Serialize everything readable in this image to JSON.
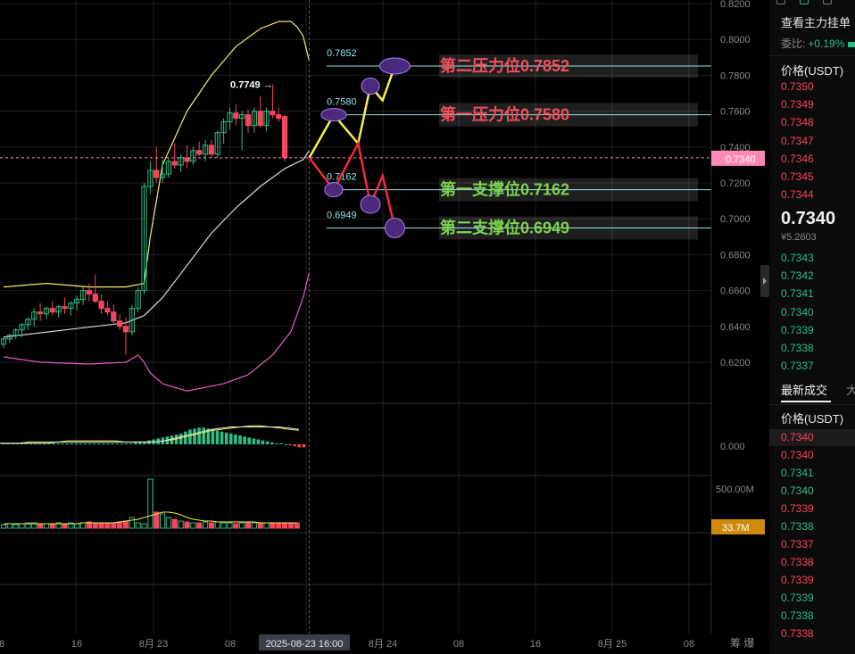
{
  "chart_data": {
    "type": "candlestick",
    "y_axis": {
      "ticks": [
        "0.8200",
        "0.8000",
        "0.7800",
        "0.7600",
        "0.7400",
        "0.7200",
        "0.7000",
        "0.6800",
        "0.6600",
        "0.6400",
        "0.6200"
      ],
      "ylim": [
        0.612,
        0.822
      ],
      "current_price_label": "0.7340"
    },
    "x_axis": {
      "ticks": [
        "8",
        "16",
        "8月 23",
        "08",
        "2025-08-23 16:00",
        "8月 24",
        "08",
        "16",
        "8月 25",
        "08"
      ],
      "crosshair_label": "2025-08-23 16:00"
    },
    "corner_label": "筹 爆",
    "candles": [
      {
        "o": 0.63,
        "h": 0.634,
        "l": 0.628,
        "c": 0.633
      },
      {
        "o": 0.633,
        "h": 0.636,
        "l": 0.631,
        "c": 0.635
      },
      {
        "o": 0.635,
        "h": 0.639,
        "l": 0.633,
        "c": 0.638
      },
      {
        "o": 0.638,
        "h": 0.642,
        "l": 0.634,
        "c": 0.641
      },
      {
        "o": 0.641,
        "h": 0.645,
        "l": 0.638,
        "c": 0.644
      },
      {
        "o": 0.644,
        "h": 0.65,
        "l": 0.64,
        "c": 0.648
      },
      {
        "o": 0.648,
        "h": 0.653,
        "l": 0.643,
        "c": 0.647
      },
      {
        "o": 0.647,
        "h": 0.651,
        "l": 0.644,
        "c": 0.65
      },
      {
        "o": 0.65,
        "h": 0.654,
        "l": 0.646,
        "c": 0.648
      },
      {
        "o": 0.648,
        "h": 0.652,
        "l": 0.645,
        "c": 0.651
      },
      {
        "o": 0.651,
        "h": 0.656,
        "l": 0.647,
        "c": 0.65
      },
      {
        "o": 0.65,
        "h": 0.654,
        "l": 0.646,
        "c": 0.653
      },
      {
        "o": 0.653,
        "h": 0.657,
        "l": 0.649,
        "c": 0.655
      },
      {
        "o": 0.655,
        "h": 0.662,
        "l": 0.652,
        "c": 0.66
      },
      {
        "o": 0.66,
        "h": 0.664,
        "l": 0.654,
        "c": 0.658
      },
      {
        "o": 0.658,
        "h": 0.669,
        "l": 0.653,
        "c": 0.654
      },
      {
        "o": 0.654,
        "h": 0.658,
        "l": 0.647,
        "c": 0.65
      },
      {
        "o": 0.65,
        "h": 0.654,
        "l": 0.646,
        "c": 0.648
      },
      {
        "o": 0.648,
        "h": 0.652,
        "l": 0.641,
        "c": 0.643
      },
      {
        "o": 0.643,
        "h": 0.647,
        "l": 0.638,
        "c": 0.64
      },
      {
        "o": 0.64,
        "h": 0.645,
        "l": 0.624,
        "c": 0.637
      },
      {
        "o": 0.637,
        "h": 0.652,
        "l": 0.635,
        "c": 0.65
      },
      {
        "o": 0.65,
        "h": 0.662,
        "l": 0.648,
        "c": 0.66
      },
      {
        "o": 0.66,
        "h": 0.72,
        "l": 0.658,
        "c": 0.718
      },
      {
        "o": 0.718,
        "h": 0.732,
        "l": 0.714,
        "c": 0.727
      },
      {
        "o": 0.727,
        "h": 0.74,
        "l": 0.72,
        "c": 0.723
      },
      {
        "o": 0.723,
        "h": 0.733,
        "l": 0.72,
        "c": 0.725
      },
      {
        "o": 0.725,
        "h": 0.734,
        "l": 0.723,
        "c": 0.732
      },
      {
        "o": 0.732,
        "h": 0.742,
        "l": 0.728,
        "c": 0.73
      },
      {
        "o": 0.73,
        "h": 0.736,
        "l": 0.726,
        "c": 0.734
      },
      {
        "o": 0.734,
        "h": 0.741,
        "l": 0.728,
        "c": 0.732
      },
      {
        "o": 0.732,
        "h": 0.74,
        "l": 0.73,
        "c": 0.738
      },
      {
        "o": 0.738,
        "h": 0.743,
        "l": 0.735,
        "c": 0.736
      },
      {
        "o": 0.736,
        "h": 0.744,
        "l": 0.732,
        "c": 0.741
      },
      {
        "o": 0.741,
        "h": 0.744,
        "l": 0.734,
        "c": 0.736
      },
      {
        "o": 0.736,
        "h": 0.749,
        "l": 0.734,
        "c": 0.748
      },
      {
        "o": 0.748,
        "h": 0.756,
        "l": 0.742,
        "c": 0.754
      },
      {
        "o": 0.754,
        "h": 0.762,
        "l": 0.75,
        "c": 0.759
      },
      {
        "o": 0.759,
        "h": 0.764,
        "l": 0.752,
        "c": 0.756
      },
      {
        "o": 0.756,
        "h": 0.76,
        "l": 0.738,
        "c": 0.758
      },
      {
        "o": 0.758,
        "h": 0.761,
        "l": 0.748,
        "c": 0.752
      },
      {
        "o": 0.752,
        "h": 0.762,
        "l": 0.748,
        "c": 0.76
      },
      {
        "o": 0.76,
        "h": 0.768,
        "l": 0.751,
        "c": 0.752
      },
      {
        "o": 0.752,
        "h": 0.762,
        "l": 0.749,
        "c": 0.76
      },
      {
        "o": 0.76,
        "h": 0.7749,
        "l": 0.756,
        "c": 0.758
      },
      {
        "o": 0.758,
        "h": 0.762,
        "l": 0.754,
        "c": 0.756
      },
      {
        "o": 0.757,
        "h": 0.758,
        "l": 0.732,
        "c": 0.734
      }
    ],
    "high_marker": {
      "price": 0.7749,
      "label": "0.7749 →"
    },
    "bands": {
      "upper": [
        [
          0,
          0.662
        ],
        [
          7,
          0.664
        ],
        [
          14,
          0.662
        ],
        [
          20,
          0.662
        ],
        [
          23,
          0.664
        ],
        [
          24,
          0.69
        ],
        [
          26,
          0.73
        ],
        [
          30,
          0.76
        ],
        [
          34,
          0.78
        ],
        [
          38,
          0.796
        ],
        [
          42,
          0.806
        ],
        [
          45,
          0.81
        ],
        [
          47,
          0.81
        ],
        [
          48,
          0.807
        ],
        [
          49,
          0.802
        ],
        [
          50,
          0.788
        ]
      ],
      "middle": [
        [
          0,
          0.634
        ],
        [
          10,
          0.638
        ],
        [
          20,
          0.642
        ],
        [
          23,
          0.646
        ],
        [
          26,
          0.656
        ],
        [
          30,
          0.674
        ],
        [
          34,
          0.692
        ],
        [
          38,
          0.706
        ],
        [
          42,
          0.718
        ],
        [
          46,
          0.728
        ],
        [
          49,
          0.733
        ],
        [
          50,
          0.738
        ]
      ],
      "lower": [
        [
          0,
          0.623
        ],
        [
          6,
          0.62
        ],
        [
          14,
          0.619
        ],
        [
          20,
          0.62
        ],
        [
          22,
          0.624
        ],
        [
          23,
          0.62
        ],
        [
          24,
          0.614
        ],
        [
          26,
          0.608
        ],
        [
          30,
          0.604
        ],
        [
          36,
          0.608
        ],
        [
          40,
          0.613
        ],
        [
          44,
          0.624
        ],
        [
          47,
          0.637
        ],
        [
          49,
          0.656
        ],
        [
          50,
          0.67
        ]
      ]
    },
    "levels": [
      {
        "price": 0.7852,
        "small_label": "0.7852",
        "label": "第二压力位0.7852",
        "color": "#f24e5c"
      },
      {
        "price": 0.758,
        "small_label": "0.7580",
        "label": "第一压力位0.7580",
        "color": "#f24e5c"
      },
      {
        "price": 0.7162,
        "small_label": "0.7162",
        "label": "第一支撑位0.7162",
        "color": "#7dd34f"
      },
      {
        "price": 0.6949,
        "small_label": "0.6949",
        "label": "第二支撑位0.6949",
        "color": "#7dd34f"
      }
    ],
    "projection_bull": [
      [
        50,
        0.734
      ],
      [
        54,
        0.758
      ],
      [
        58,
        0.742
      ],
      [
        60,
        0.774
      ],
      [
        62,
        0.766
      ],
      [
        64,
        0.7852
      ]
    ],
    "projection_bear": [
      [
        50,
        0.734
      ],
      [
        54,
        0.7162
      ],
      [
        58,
        0.742
      ],
      [
        60,
        0.708
      ],
      [
        62,
        0.724
      ],
      [
        64,
        0.6949
      ]
    ],
    "macd": {
      "zero_label": "0.000",
      "hist": [
        1,
        1,
        1,
        1,
        1,
        1,
        1,
        1,
        1,
        1,
        1,
        1,
        1,
        1,
        1,
        1,
        1,
        1,
        1,
        1,
        1,
        1,
        1,
        1,
        1,
        1,
        1,
        1,
        1,
        2,
        2,
        3,
        4,
        5,
        6,
        7,
        8,
        9,
        10,
        11,
        13,
        15,
        16,
        17,
        17,
        16,
        15,
        14,
        13,
        12,
        11,
        10,
        9,
        8,
        7,
        6,
        5,
        4,
        3,
        2,
        1,
        1,
        0,
        -1,
        -2,
        -3,
        -3
      ],
      "line_a": [
        1,
        1,
        1,
        2,
        2,
        2,
        2,
        3,
        3,
        3,
        3,
        3,
        3,
        2,
        2,
        2,
        2,
        3,
        4,
        6,
        8,
        10,
        12,
        13,
        14,
        15,
        15,
        15,
        15,
        14,
        13,
        12
      ],
      "line_b": [
        1,
        1,
        1,
        1,
        1,
        1,
        2,
        2,
        2,
        2,
        2,
        2,
        2,
        2,
        2,
        2,
        2,
        3,
        5,
        7,
        9,
        11,
        13,
        14,
        15,
        15,
        16,
        16,
        15,
        15,
        14,
        13
      ]
    },
    "volume": {
      "axis_label": "500.00M",
      "current_label": "33.7M",
      "values": [
        4,
        5,
        4,
        5,
        6,
        6,
        5,
        5,
        5,
        6,
        5,
        6,
        5,
        6,
        7,
        6,
        5,
        6,
        6,
        7,
        8,
        12,
        6,
        5,
        55,
        18,
        16,
        12,
        10,
        8,
        7,
        6,
        6,
        7,
        6,
        7,
        6,
        6,
        5,
        6,
        7,
        6,
        6,
        6,
        5,
        6,
        5,
        6,
        6
      ],
      "ma": [
        5,
        5,
        5,
        5,
        5,
        5,
        5,
        5,
        5,
        5,
        5,
        5,
        5,
        6,
        6,
        6,
        6,
        6,
        6,
        7,
        8,
        9,
        10,
        12,
        14,
        16,
        18,
        18,
        17,
        15,
        12,
        10,
        9,
        8,
        8,
        7,
        7,
        7,
        7,
        7,
        7,
        7,
        6,
        6,
        6,
        6,
        6,
        6,
        6
      ]
    },
    "colors": {
      "up": "#2ebd85",
      "down": "#f6465d",
      "upper_band": "#f3f163",
      "middle_band": "#d9d9d9",
      "lower_band": "#e45fbd",
      "accent": "#ff8ab8",
      "vol_label": "#d08a0a",
      "grid": "#1f1f1f"
    }
  },
  "sidebar": {
    "title": "查看主力挂单",
    "ratio_label": "委比:",
    "ratio_value": "+0.19%",
    "price_header": "价格(USDT)",
    "asks": [
      "0.7350",
      "0.7349",
      "0.7348",
      "0.7347",
      "0.7346",
      "0.7345",
      "0.7344"
    ],
    "last_price": "0.7340",
    "last_price_sub": "¥5.2603",
    "bids": [
      "0.7343",
      "0.7342",
      "0.7341",
      "0.7340",
      "0.7339",
      "0.7338",
      "0.7337"
    ],
    "trades_tab": "最新成交",
    "trades_tab2": "大",
    "trades_header": "价格(USDT)",
    "trades": [
      {
        "price": "0.7340",
        "side": "red"
      },
      {
        "price": "0.7340",
        "side": "red"
      },
      {
        "price": "0.7341",
        "side": "green"
      },
      {
        "price": "0.7340",
        "side": "green"
      },
      {
        "price": "0.7339",
        "side": "red"
      },
      {
        "price": "0.7338",
        "side": "green"
      },
      {
        "price": "0.7337",
        "side": "red"
      },
      {
        "price": "0.7338",
        "side": "red"
      },
      {
        "price": "0.7339",
        "side": "red"
      },
      {
        "price": "0.7339",
        "side": "green"
      },
      {
        "price": "0.7338",
        "side": "green"
      },
      {
        "price": "0.7338",
        "side": "red"
      }
    ]
  }
}
